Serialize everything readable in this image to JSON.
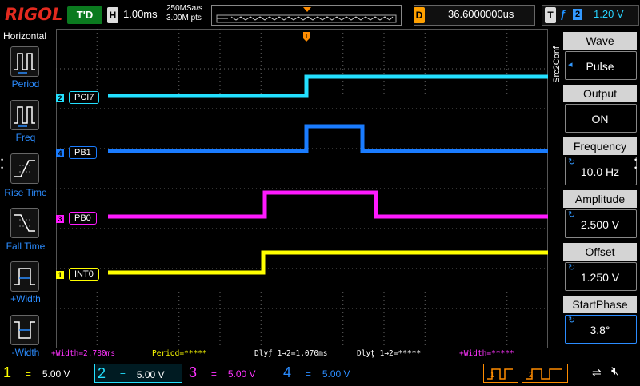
{
  "header": {
    "logo": "RIGOL",
    "run_state": "T'D",
    "h_label": "H",
    "timebase": "1.00ms",
    "sample_rate": "250MSa/s",
    "memory_points": "3.00M pts",
    "d_label": "D",
    "delay": "36.6000000us",
    "t_label": "T",
    "trigger_edge_symbol": "ƒ",
    "trigger_source": "2",
    "trigger_level": "1.20 V"
  },
  "left_menu": {
    "title": "Horizontal",
    "items": [
      {
        "label": "Period",
        "icon": "period-icon"
      },
      {
        "label": "Freq",
        "icon": "freq-icon"
      },
      {
        "label": "Rise Time",
        "icon": "rise-time-icon"
      },
      {
        "label": "Fall Time",
        "icon": "fall-time-icon"
      },
      {
        "label": "+Width",
        "icon": "positive-width-icon"
      },
      {
        "label": "-Width",
        "icon": "negative-width-icon"
      }
    ]
  },
  "channels": {
    "ch2": {
      "label": "PCI7",
      "mark": "2",
      "color": "#23e0ff"
    },
    "ch4": {
      "label": "PB1",
      "mark": "4",
      "color": "#1a7cff"
    },
    "ch3": {
      "label": "PB0",
      "mark": "3",
      "color": "#ff1aff"
    },
    "ch1": {
      "label": "INT0",
      "mark": "1",
      "color": "#ffff00"
    }
  },
  "trigger_position_marker": "T",
  "measurements": {
    "pos_width_1": "+Width=2.780ms",
    "period": "Period=*****",
    "delay_rise": "Dlyƒ 1→2=1.070ms",
    "delay_fall": "Dlyț 1→2=*****",
    "pos_width_2": "+Width=*****"
  },
  "bottom_bar": {
    "ch1": {
      "num": "1",
      "coupling": "=",
      "scale": "5.00 V",
      "color": "#ffff00"
    },
    "ch2": {
      "num": "2",
      "coupling": "=",
      "scale": "5.00 V",
      "color": "#23e0ff"
    },
    "ch3": {
      "num": "3",
      "coupling": "=",
      "scale": "5.00 V",
      "color": "#ff33ff"
    },
    "ch4": {
      "num": "4",
      "coupling": "=",
      "scale": "5.00 V",
      "color": "#2b8cff"
    },
    "gen1": "1",
    "gen2": "2"
  },
  "right_panel": {
    "side_label": "Src2Conf",
    "wave_title": "Wave",
    "wave_value": "Pulse",
    "output_title": "Output",
    "output_value": "ON",
    "frequency_title": "Frequency",
    "frequency_value": "10.0 Hz",
    "amplitude_title": "Amplitude",
    "amplitude_value": "2.500 V",
    "offset_title": "Offset",
    "offset_value": "1.250 V",
    "startphase_title": "StartPhase",
    "startphase_value": "3.8°"
  },
  "colors": {
    "ch1": "#ffff00",
    "ch2": "#23e0ff",
    "ch3": "#ff1aff",
    "ch4": "#1a7cff",
    "logo": "#e32a1f",
    "run_state_bg": "#0b7a1f",
    "trigger_marker": "#ff8c00"
  }
}
